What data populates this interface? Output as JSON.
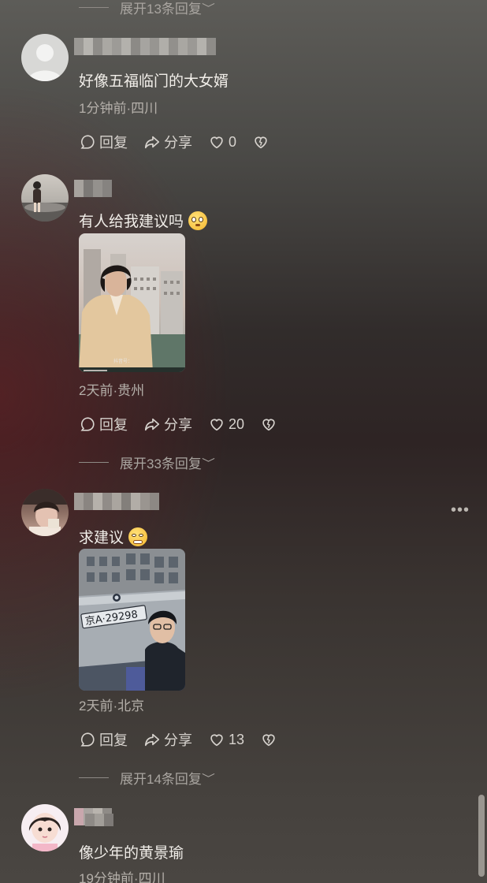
{
  "expand_labels": [
    "展开13条回复",
    "展开33条回复",
    "展开14条回复"
  ],
  "comments": [
    {
      "text": "好像五福临门的大女婿",
      "meta": "1分钟前·四川",
      "actions": {
        "reply": "回复",
        "share": "分享",
        "likes": "0"
      }
    },
    {
      "text": "有人给我建议吗",
      "emoji": "flushed-face-emoji",
      "thumb_caption": "抖音号：",
      "meta": "2天前·贵州",
      "actions": {
        "reply": "回复",
        "share": "分享",
        "likes": "20"
      }
    },
    {
      "text": "求建议",
      "emoji": "grimacing-face-emoji",
      "plate": "京A·29298",
      "meta": "2天前·北京",
      "actions": {
        "reply": "回复",
        "share": "分享",
        "likes": "13"
      }
    },
    {
      "text": "像少年的黄景瑜",
      "meta": "19分钟前·四川"
    }
  ],
  "more_icon": "•••",
  "colors": {
    "text": "#f1eee9",
    "meta": "#b5b0aa",
    "emoji": "#f5b52c"
  }
}
